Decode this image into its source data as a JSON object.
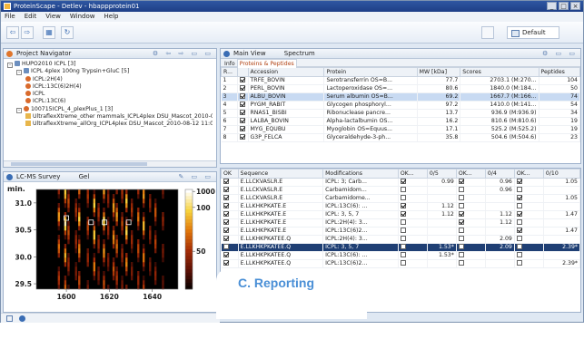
{
  "window": {
    "title": "ProteinScape - Detlev - hbappprotein01",
    "buttons": [
      "_",
      "□",
      "×"
    ]
  },
  "menu": [
    "File",
    "Edit",
    "View",
    "Window",
    "Help"
  ],
  "toolbar": {
    "perspective_label": "Default"
  },
  "navigator": {
    "title": "Project Navigator",
    "items": [
      {
        "indent": 0,
        "kind": "db",
        "text": "HUPO2010 ICPL [3]"
      },
      {
        "indent": 1,
        "kind": "db",
        "text": "ICPL 4plex 100ng Trypsin+GluC [5]"
      },
      {
        "indent": 2,
        "kind": "sm",
        "text": "ICPL:2H(4)"
      },
      {
        "indent": 2,
        "kind": "sm",
        "text": "ICPL:13C(6)2H(4)"
      },
      {
        "indent": 2,
        "kind": "sm",
        "text": "ICPL"
      },
      {
        "indent": 2,
        "kind": "sm",
        "text": "ICPL:13C(6)"
      },
      {
        "indent": 1,
        "kind": "sm",
        "text": "100715ICPL_4_plexPlus_1 [3]"
      },
      {
        "indent": 2,
        "kind": "fl",
        "text": "UltraflexXtreme_other mammals_ICPL4plex DSU_Mascot_2010-08-12 11:4("
      },
      {
        "indent": 2,
        "kind": "fl",
        "text": "UltraflexXtreme_allOrg_ICPL4plex DSU_Mascot_2010-08-12 11:02:13"
      }
    ]
  },
  "survey": {
    "tabs": [
      "LC-MS Survey",
      "Gel"
    ]
  },
  "chart_data": {
    "type": "heatmap",
    "xlabel": "",
    "ylabel": "min.",
    "x_ticks": [
      1600,
      1620,
      1640
    ],
    "y_ticks": [
      29.5,
      30.0,
      30.5,
      31.0
    ],
    "xlim": [
      1586,
      1652
    ],
    "ylim": [
      29.4,
      31.25
    ],
    "colorbar_ticks": [
      1000,
      100,
      50
    ],
    "colorbar_scale": "log",
    "colors": [
      "#000000",
      "#5a1005",
      "#a32b06",
      "#e0760a",
      "#f7d23c",
      "#ffffff"
    ],
    "columns": [
      {
        "x": 1596.5,
        "i": 0.7
      },
      {
        "x": 1599.5,
        "i": 0.95
      },
      {
        "x": 1601,
        "i": 0.55
      },
      {
        "x": 1604.5,
        "i": 0.45
      },
      {
        "x": 1606,
        "i": 0.8
      },
      {
        "x": 1610,
        "i": 0.5
      },
      {
        "x": 1613,
        "i": 0.9
      },
      {
        "x": 1615,
        "i": 0.45
      },
      {
        "x": 1617.5,
        "i": 0.85
      },
      {
        "x": 1619.5,
        "i": 0.4
      },
      {
        "x": 1622,
        "i": 0.75
      },
      {
        "x": 1623.5,
        "i": 0.7
      },
      {
        "x": 1626,
        "i": 0.5
      },
      {
        "x": 1628,
        "i": 0.9
      },
      {
        "x": 1630.5,
        "i": 0.45
      },
      {
        "x": 1633.5,
        "i": 0.6
      },
      {
        "x": 1636,
        "i": 0.8
      },
      {
        "x": 1639,
        "i": 0.4
      },
      {
        "x": 1641.5,
        "i": 0.55
      },
      {
        "x": 1645,
        "i": 0.35
      }
    ],
    "markers": [
      {
        "x": 1600,
        "y": 30.72
      },
      {
        "x": 1611.5,
        "y": 30.64
      },
      {
        "x": 1617.8,
        "y": 30.64
      },
      {
        "x": 1629,
        "y": 30.64
      }
    ]
  },
  "main": {
    "tabs": [
      "Main View",
      "Spectrum"
    ],
    "subtabs": [
      "Info",
      "Proteins & Peptides"
    ],
    "protein_columns": [
      "R...",
      "",
      "Accession",
      "Protein",
      "MW [kDa]",
      "Scores",
      "Peptides"
    ],
    "proteins": [
      {
        "r": "1",
        "on": true,
        "acc": "TRFE_BOVIN",
        "protein": "Serotransferrin OS=B...",
        "mw": "77.7",
        "score": "2703.1 (M:270...",
        "pep": "104",
        "sel": false
      },
      {
        "r": "2",
        "on": true,
        "acc": "PERL_BOVIN",
        "protein": "Lactoperoxidase OS=...",
        "mw": "80.6",
        "score": "1840.0 (M:184...",
        "pep": "50",
        "sel": false
      },
      {
        "r": "3",
        "on": true,
        "acc": "ALBU_BOVIN",
        "protein": "Serum albumin OS=B...",
        "mw": "69.2",
        "score": "1667.7 (M:166...",
        "pep": "74",
        "sel": true
      },
      {
        "r": "4",
        "on": true,
        "acc": "PYGM_RABIT",
        "protein": "Glycogen phosphoryl...",
        "mw": "97.2",
        "score": "1410.0 (M:141...",
        "pep": "54",
        "sel": false
      },
      {
        "r": "5",
        "on": true,
        "acc": "RNAS1_BISBI",
        "protein": "Ribonuclease pancre...",
        "mw": "13.7",
        "score": "936.9 (M:936.9)",
        "pep": "34",
        "sel": false
      },
      {
        "r": "6",
        "on": true,
        "acc": "LALBA_BOVIN",
        "protein": "Alpha-lactalbumin OS...",
        "mw": "16.2",
        "score": "810.6 (M:810.6)",
        "pep": "19",
        "sel": false
      },
      {
        "r": "7",
        "on": true,
        "acc": "MYG_EQUBU",
        "protein": "Myoglobin OS=Equus...",
        "mw": "17.1",
        "score": "525.2 (M:525.2)",
        "pep": "19",
        "sel": false
      },
      {
        "r": "8",
        "on": true,
        "acc": "G3P_FELCA",
        "protein": "Glyceraldehyde-3-ph...",
        "mw": "35.8",
        "score": "504.6 (M:504.6)",
        "pep": "23",
        "sel": false
      }
    ],
    "peptide_columns": [
      "OK",
      "Sequence",
      "Modifications",
      "OK...",
      "0/5",
      "OK...",
      "0/4",
      "OK...",
      "0/10"
    ],
    "peptides": [
      {
        "ok": true,
        "seq": "E.LLCKVASLR.E",
        "mod": "ICPL: 3; Carb...",
        "c1": true,
        "v1": "0.99",
        "c2": true,
        "v2": "0.96",
        "c3": true,
        "v3": "1.05",
        "style": ""
      },
      {
        "ok": true,
        "seq": "E.LLCKVASLR.E",
        "mod": "Carbamidom...",
        "c1": false,
        "v1": "",
        "c2": false,
        "v2": "0.96",
        "c3": false,
        "v3": "",
        "style": ""
      },
      {
        "ok": true,
        "seq": "E.LLCKVASLR.E",
        "mod": "Carbamidome...",
        "c1": false,
        "v1": "",
        "c2": false,
        "v2": "",
        "c3": true,
        "v3": "1.05",
        "style": ""
      },
      {
        "ok": true,
        "seq": "E.LLKHKPKATE.E",
        "mod": "ICPL:13C(6): ...",
        "c1": true,
        "v1": "1.12",
        "c2": false,
        "v2": "",
        "c3": false,
        "v3": "",
        "style": ""
      },
      {
        "ok": true,
        "seq": "E.LLKHKPKATE.E",
        "mod": "ICPL: 3, 5, 7",
        "c1": true,
        "v1": "1.12",
        "c2": true,
        "v2": "1.12",
        "c3": true,
        "v3": "1.47",
        "style": ""
      },
      {
        "ok": true,
        "seq": "E.LLKHKPKATE.E",
        "mod": "ICPL:2H(4): 3...",
        "c1": false,
        "v1": "",
        "c2": true,
        "v2": "1.12",
        "c3": false,
        "v3": "",
        "style": ""
      },
      {
        "ok": true,
        "seq": "E.LLKHKPKATE.E",
        "mod": "ICPL:13C(6)2...",
        "c1": false,
        "v1": "",
        "c2": false,
        "v2": "",
        "c3": true,
        "v3": "1.47",
        "style": ""
      },
      {
        "ok": true,
        "seq": "E.LLKHKPKATEE.Q",
        "mod": "ICPL:2H(4): 3...",
        "c1": false,
        "v1": "",
        "c2": false,
        "v2": "2.09",
        "c3": false,
        "v3": "",
        "style": ""
      },
      {
        "ok": false,
        "seq": "E.LLKHKPKATEE.Q",
        "mod": "ICPL: 3, 5, 7",
        "c1": false,
        "v1": "1.53*",
        "c2": false,
        "v2": "2.09",
        "c3": false,
        "v3": "2.39*",
        "style": "dark"
      },
      {
        "ok": true,
        "seq": "E.LLKHKPKATEE.Q",
        "mod": "ICPL:13C(6): ...",
        "c1": false,
        "v1": "1.53*",
        "c2": false,
        "v2": "",
        "c3": false,
        "v3": "",
        "style": ""
      },
      {
        "ok": true,
        "seq": "E.LLKHKPKATEE.Q",
        "mod": "ICPL:13C(6)2...",
        "c1": false,
        "v1": "",
        "c2": false,
        "v2": "",
        "c3": false,
        "v3": "2.39*",
        "style": ""
      }
    ]
  },
  "callout": {
    "text": "C. Reporting"
  }
}
